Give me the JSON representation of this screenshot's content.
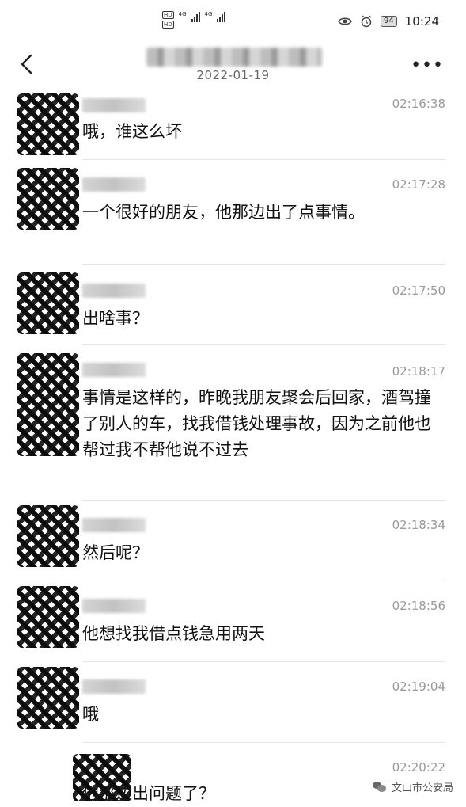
{
  "status_bar": {
    "left_indicators": [
      "HD",
      "4G",
      "HD",
      "4G"
    ],
    "battery": "94",
    "clock": "10:24",
    "icons": [
      "eye-icon",
      "alarm-icon"
    ]
  },
  "header": {
    "back_icon": "chevron-left-icon",
    "date": "2022-01-19",
    "more_icon": "more-horizontal-icon",
    "more_label": "•••"
  },
  "messages": [
    {
      "time": "02:16:38",
      "text": "哦，谁这么坏"
    },
    {
      "time": "02:17:28",
      "text": "一个很好的朋友，他那边出了点事情。"
    },
    {
      "time": "02:17:50",
      "text": "出啥事？"
    },
    {
      "time": "02:18:17",
      "text": "事情是这样的，昨晚我朋友聚会后回家，酒驾撞了别人的车，找我借钱处理事故，因为之前他也帮过我不帮他说不过去"
    },
    {
      "time": "02:18:34",
      "text": "然后呢？"
    },
    {
      "time": "02:18:56",
      "text": "他想找我借点钱急用两天"
    },
    {
      "time": "02:19:04",
      "text": "哦"
    },
    {
      "time": "02:20:22",
      "text": "他那边出问题了？"
    }
  ],
  "watermark": {
    "label": "文山市公安局"
  }
}
